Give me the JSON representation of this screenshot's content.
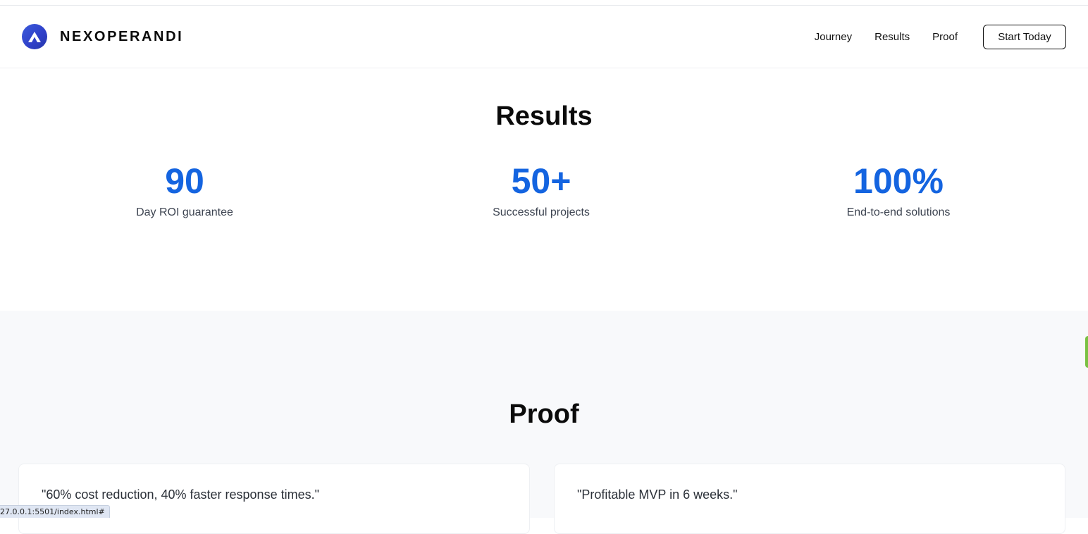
{
  "header": {
    "brand_name": "NEXOPERANDI",
    "nav": [
      "Journey",
      "Results",
      "Proof"
    ],
    "cta_label": "Start Today"
  },
  "results": {
    "title": "Results",
    "stats": [
      {
        "value": "90",
        "label": "Day ROI guarantee"
      },
      {
        "value": "50+",
        "label": "Successful projects"
      },
      {
        "value": "100%",
        "label": "End-to-end solutions"
      }
    ]
  },
  "proof": {
    "title": "Proof",
    "testimonials": [
      {
        "quote": "\"60% cost reduction, 40% faster response times.\""
      },
      {
        "quote": "\"Profitable MVP in 6 weeks.\""
      }
    ]
  },
  "status_bar": {
    "url": "27.0.0.1:5501/index.html#"
  },
  "colors": {
    "accent_blue": "#1464e0",
    "logo_blue": "#3b5bdb",
    "proof_bg": "#f8f9fb",
    "side_tab_green": "#7ac143"
  },
  "icons": {
    "logo": "logo-icon"
  }
}
